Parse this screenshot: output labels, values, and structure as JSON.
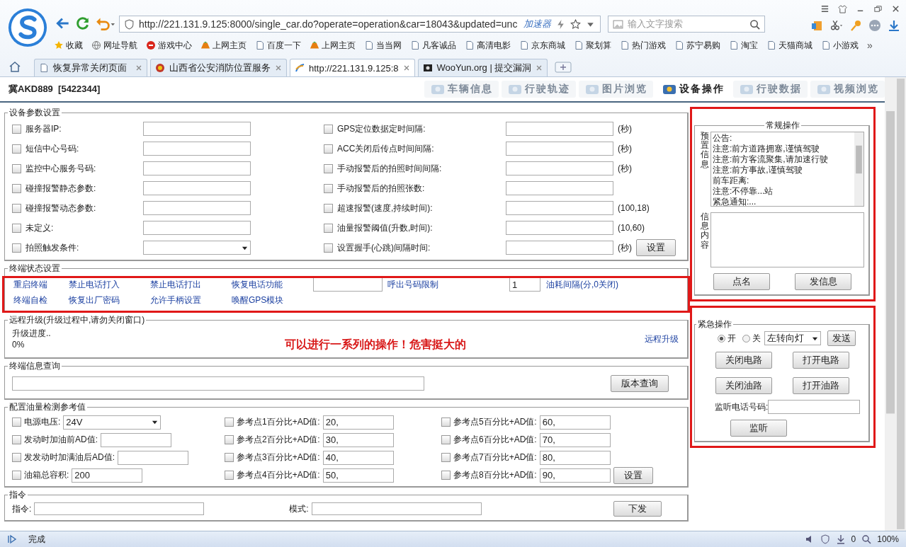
{
  "browser": {
    "address": "http://221.131.9.125:8000/single_car.do?operate=operation&car=18043&updated=unc",
    "accelerator": "加速器",
    "search_placeholder": "输入文字搜索",
    "bookmarks": [
      {
        "label": "收藏",
        "kind": "star"
      },
      {
        "label": "网址导航",
        "kind": "globe"
      },
      {
        "label": "游戏中心",
        "kind": "game"
      },
      {
        "label": "上网主页",
        "kind": "hao"
      },
      {
        "label": "百度一下",
        "kind": "page"
      },
      {
        "label": "上网主页",
        "kind": "hao"
      },
      {
        "label": "当当网",
        "kind": "page"
      },
      {
        "label": "凡客诚品",
        "kind": "page"
      },
      {
        "label": "高清电影",
        "kind": "page"
      },
      {
        "label": "京东商城",
        "kind": "page"
      },
      {
        "label": "聚划算",
        "kind": "page"
      },
      {
        "label": "热门游戏",
        "kind": "page"
      },
      {
        "label": "苏宁易购",
        "kind": "page"
      },
      {
        "label": "淘宝",
        "kind": "page"
      },
      {
        "label": "天猫商城",
        "kind": "page"
      },
      {
        "label": "小游戏",
        "kind": "page"
      }
    ],
    "more_bookmarks": "»",
    "tabs": [
      {
        "label": "恢复异常关闭页面",
        "kind": "page",
        "selected": false
      },
      {
        "label": "山西省公安消防位置服务",
        "kind": "emblem",
        "selected": false
      },
      {
        "label": "http://221.131.9.125:8",
        "kind": "site",
        "selected": true
      },
      {
        "label": "WooYun.org | 提交漏洞",
        "kind": "dark",
        "selected": false
      }
    ]
  },
  "vehicle": "冀AKD889  [5422344]",
  "nav_tabs": [
    {
      "label": "车辆信息",
      "selected": false
    },
    {
      "label": "行驶轨迹",
      "selected": false
    },
    {
      "label": "图片浏览",
      "selected": false
    },
    {
      "label": "设备操作",
      "selected": true
    },
    {
      "label": "行驶数据",
      "selected": false
    },
    {
      "label": "视频浏览",
      "selected": false
    }
  ],
  "device_params": {
    "title": "设备参数设置",
    "set_button": "设置",
    "left": [
      {
        "kind": "input",
        "label": "服务器IP:",
        "checked": false
      },
      {
        "kind": "input",
        "label": "短信中心号码:",
        "checked": false
      },
      {
        "kind": "input",
        "label": "监控中心服务号码:",
        "checked": false
      },
      {
        "kind": "input",
        "label": "碰撞报警静态参数:",
        "checked": false
      },
      {
        "kind": "input",
        "label": "碰撞报警动态参数:",
        "checked": false
      },
      {
        "kind": "input",
        "label": "未定义:",
        "checked": false
      },
      {
        "kind": "select",
        "label": "拍照触发条件:",
        "checked": false
      }
    ],
    "right": [
      {
        "kind": "input",
        "label": "GPS定位数据定时间隔:",
        "unit": "(秒)",
        "checked": false
      },
      {
        "kind": "input",
        "label": "ACC关闭后传点时间间隔:",
        "unit": "(秒)",
        "checked": false
      },
      {
        "kind": "input",
        "label": "手动报警后的拍照时间间隔:",
        "unit": "(秒)",
        "checked": false
      },
      {
        "kind": "input",
        "label": "手动报警后的拍照张数:",
        "checked": false
      },
      {
        "kind": "input",
        "label": "超速报警(速度,持续时间):",
        "unit": "(100,18)",
        "checked": false
      },
      {
        "kind": "input",
        "label": "油量报警阈值(升数,时间):",
        "unit": "(10,60)",
        "checked": false
      },
      {
        "kind": "input",
        "label": "设置握手(心跳)间隔时间:",
        "unit": "(秒)",
        "checked": false
      }
    ]
  },
  "terminal_status": {
    "title": "终端状态设置",
    "rows": [
      [
        {
          "kind": "link",
          "text": "重启终端"
        },
        {
          "kind": "link",
          "text": "禁止电话打入"
        },
        {
          "kind": "link",
          "text": "禁止电话打出"
        },
        {
          "kind": "link",
          "text": "恢复电话功能"
        },
        {
          "kind": "input"
        },
        {
          "kind": "link",
          "text": "呼出号码限制"
        },
        {
          "kind": "input",
          "value": "1"
        },
        {
          "kind": "link",
          "text": "油耗间隔(分,0关闭)"
        }
      ],
      [
        {
          "kind": "link",
          "text": "终端自检"
        },
        {
          "kind": "link",
          "text": "恢复出厂密码"
        },
        {
          "kind": "link",
          "text": "允许手柄设置"
        },
        {
          "kind": "link",
          "text": "唤醒GPS模块"
        }
      ]
    ]
  },
  "remote_upgrade": {
    "title": "远程升级(升级过程中,请勿关闭窗口)",
    "progress_label": "升级进度..",
    "progress": "0%",
    "link": "远程升级"
  },
  "annotation": "可以进行一系列的操作！危害挺大的",
  "info_query": {
    "title": "终端信息查询",
    "button": "版本查询"
  },
  "oil_config": {
    "title": "配置油量检测参考值",
    "set_button": "设置",
    "columns": [
      [
        {
          "kind": "select",
          "label": "电源电压:",
          "value": "24V",
          "checked": false
        },
        {
          "kind": "input",
          "label": "发动时加油前AD值:",
          "checked": false
        },
        {
          "kind": "input",
          "label": "发发动时加满油后AD值:",
          "checked": false
        },
        {
          "kind": "input",
          "label": "油箱总容积:",
          "value": "200",
          "checked": false
        }
      ],
      [
        {
          "kind": "input",
          "label": "参考点1百分比+AD值:",
          "value": "20,",
          "checked": false
        },
        {
          "kind": "input",
          "label": "参考点2百分比+AD值:",
          "value": "30,",
          "checked": false
        },
        {
          "kind": "input",
          "label": "参考点3百分比+AD值:",
          "value": "40,",
          "checked": false
        },
        {
          "kind": "input",
          "label": "参考点4百分比+AD值:",
          "value": "50,",
          "checked": false
        }
      ],
      [
        {
          "kind": "input",
          "label": "参考点5百分比+AD值:",
          "value": "60,",
          "checked": false
        },
        {
          "kind": "input",
          "label": "参考点6百分比+AD值:",
          "value": "70,",
          "checked": false
        },
        {
          "kind": "input",
          "label": "参考点7百分比+AD值:",
          "value": "80,",
          "checked": false
        },
        {
          "kind": "input",
          "label": "参考点8百分比+AD值:",
          "value": "90,",
          "checked": false
        }
      ]
    ]
  },
  "command": {
    "title": "指令",
    "command_label": "指令:",
    "mode_label": "模式:",
    "button": "下发"
  },
  "routine": {
    "title": "常规操作",
    "preset_label": "预置信息",
    "presets": [
      "公告:",
      "注意:前方道路拥塞,谨慎驾驶",
      "注意:前方客流聚集,请加速行驶",
      "注意:前方事故,谨慎驾驶",
      "前车距离:",
      "注意:不停靠...站",
      "紧急通知:..."
    ],
    "content_label": "信息内容",
    "buttons": [
      "点名",
      "发信息"
    ]
  },
  "emergency": {
    "title": "紧急操作",
    "radios": [
      {
        "label": "开",
        "selected": true
      },
      {
        "label": "关",
        "selected": false
      }
    ],
    "select": "左转向灯",
    "send": "发送",
    "buttons": [
      "关闭电路",
      "打开电路",
      "关闭油路",
      "打开油路"
    ],
    "phone_label": "监听电话号码:",
    "listen": "监听"
  },
  "status_bar": {
    "text": "完成",
    "count": "0",
    "zoom": "100%"
  }
}
